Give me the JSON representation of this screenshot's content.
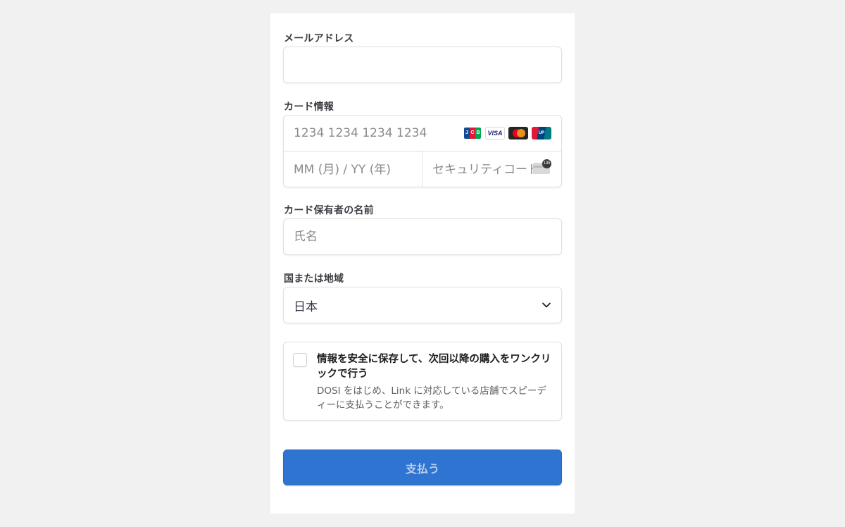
{
  "email": {
    "label": "メールアドレス",
    "value": "",
    "placeholder": ""
  },
  "card": {
    "label": "カード情報",
    "number_placeholder": "1234 1234 1234 1234",
    "expiry_placeholder": "MM (月) / YY (年)",
    "cvc_placeholder": "セキュリティコード",
    "cvc_badge": "135",
    "brands": [
      "jcb-icon",
      "visa-icon",
      "mastercard-icon",
      "unionpay-icon"
    ],
    "visa_text": "VISA"
  },
  "cardholder": {
    "label": "カード保有者の名前",
    "placeholder": "氏名"
  },
  "country": {
    "label": "国または地域",
    "selected": "日本"
  },
  "link": {
    "title": "情報を安全に保存して、次回以降の購入をワンクリックで行う",
    "description": "DOSI をはじめ、Link に対応している店舗でスピーディーに支払うことができます。",
    "checked": false
  },
  "pay_button": {
    "label": "支払う",
    "color": "#2f74d0"
  }
}
